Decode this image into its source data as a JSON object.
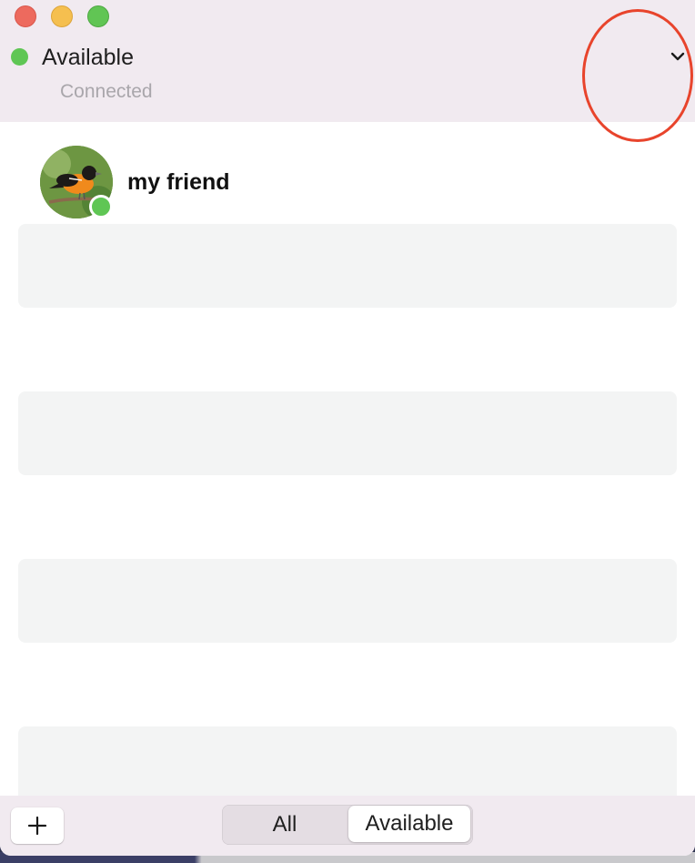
{
  "status": {
    "label": "Available",
    "subtitle": "Connected",
    "color": "#5fc654",
    "dropdown_icon": "chevron-down-icon"
  },
  "contacts": [
    {
      "name": "my friend",
      "presence": "available",
      "avatar": "bird-photo"
    }
  ],
  "filter": {
    "options": [
      "All",
      "Available"
    ],
    "selected": "Available"
  },
  "toolbar": {
    "add_icon": "plus-icon"
  },
  "colors": {
    "accent_red": "#e8442c",
    "titlebar_bg": "#f1eaf0",
    "placeholder_bg": "#f3f4f4"
  }
}
